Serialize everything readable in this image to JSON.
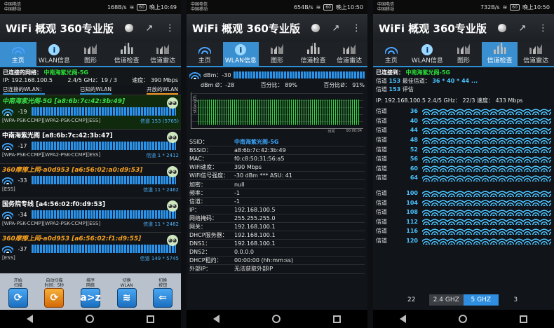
{
  "statusbars": [
    {
      "carrier1": "中国电信",
      "carrier2": "中国移动",
      "speed": "168B/s",
      "battery": "60",
      "time": "晚上10:49"
    },
    {
      "carrier1": "中国电信",
      "carrier2": "中国移动",
      "speed": "654B/s",
      "battery": "60",
      "time": "晚上10:50"
    },
    {
      "carrier1": "中国电信",
      "carrier2": "中国移动",
      "speed": "732B/s",
      "battery": "60",
      "time": "晚上10:50"
    }
  ],
  "app_title": "WiFi 概观 360专业版",
  "tabs": [
    "主页",
    "WLAN信息",
    "图形",
    "信道检查",
    "信道雷达"
  ],
  "panel1": {
    "connected_label": "已连接的网络：",
    "connected_ssid": "中南海紫光阁-5G",
    "ip_line": "IP: 192.168.100.5",
    "band_line": "2.4/5 GHz：19 / 3",
    "speed_line": "速度：  390 Mbps",
    "filter_connected": "已连接的WLAN：",
    "filter_known": "已知的WLAN",
    "filter_open": "开放的WLAN",
    "networks": [
      {
        "name": "中南海紫光阁-5G [a8:6b:7c:42:3b:49]",
        "dbm": "-19",
        "sec": "[WPA-PSK-CCMP][WPA2-PSK-CCMP][ESS]",
        "ch": "信道 153 (5765)",
        "style": "g"
      },
      {
        "name": "中南海紫光阁 [a8:6b:7c:42:3b:47]",
        "dbm": "-17",
        "sec": "[WPA-PSK-CCMP][WPA2-PSK-CCMP][ESS]",
        "ch": "信道 1 * 2412",
        "style": "w"
      },
      {
        "name": "360摩擦上网-a0d953 [a6:56:02:a0:d9:53]",
        "dbm": "-33",
        "sec": "[ESS]",
        "ch": "信道 11 * 2462",
        "style": "o"
      },
      {
        "name": "国务院专线 [a4:56:02:f0:d9:53]",
        "dbm": "-34",
        "sec": "[WPA-PSK-CCMP][WPA2-PSK-CCMP][ESS]",
        "ch": "信道 11 * 2462",
        "style": "w"
      },
      {
        "name": "360摩擦上网-a0d953 [a6:56:02:f1:d9:55]",
        "dbm": "-37",
        "sec": "[ESS]",
        "ch": "信道 149 * 5745",
        "style": "o"
      }
    ],
    "toolbar": [
      {
        "label": "开始\n扫描",
        "icon": "⟳",
        "style": "blue"
      },
      {
        "label": "自动扫描\n时间：5秒",
        "icon": "⟳",
        "style": "orange"
      },
      {
        "label": "排序\n网络",
        "icon": "a>z",
        "style": "blue"
      },
      {
        "label": "切换\nWLAN",
        "icon": "≋",
        "style": "blue"
      },
      {
        "label": "切换\n按钮",
        "icon": "⇐",
        "style": "blue"
      }
    ]
  },
  "panel2": {
    "dbm_label": "dBm：-30",
    "dbm_avg": "dBm Ø：-28",
    "pct": "百分比：  89%",
    "pct_avg": "百分比Ø：  91%",
    "graph_ylabel": "strength",
    "graph_t1": "时间",
    "graph_t2": "00:00:04",
    "rows": [
      {
        "k": "SSID：",
        "v": "中南海紫光阁-5G",
        "b": true
      },
      {
        "k": "BSSID：",
        "v": "a8:6b:7c:42:3b:49"
      },
      {
        "k": "MAC：",
        "v": "f0:c8:50:31:56:a5"
      },
      {
        "k": "WiFi速度：",
        "v": "390 Mbps"
      },
      {
        "k": "WiFi信号强度：",
        "v": "-30 dBm *** ASU: 41"
      },
      {
        "k": "加密：",
        "v": "null"
      },
      {
        "k": "频率：",
        "v": "-1"
      },
      {
        "k": "信道：",
        "v": "-1"
      },
      {
        "k": "IP：",
        "v": "192.168.100.5"
      },
      {
        "k": "网络掩码：",
        "v": "255.255.255.0"
      },
      {
        "k": "网关：",
        "v": "192.168.100.1"
      },
      {
        "k": "DHCP服务器：",
        "v": "192.168.100.1"
      },
      {
        "k": "DNS1：",
        "v": "192.168.100.1"
      },
      {
        "k": "DNS2：",
        "v": "0.0.0.0"
      },
      {
        "k": "DHCP租约：",
        "v": "00:00:00 (hh:mm:ss)"
      },
      {
        "k": "外部IP：",
        "v": "无法获取外部IP"
      }
    ]
  },
  "panel3": {
    "connected_label": "已连接到：",
    "connected_ssid": "中南海紫光阁-5G",
    "ch_label": "信道",
    "ch_val": "153",
    "best_label": "最佳信道：",
    "best_val": "36 * 40 * 44 ...",
    "rating_label": "信道",
    "rating_val": "153",
    "rating_word": "评估",
    "ip_line": "IP: 192.168.100.5   2.4/5 GHz： 22/3   速度：  433 Mbps",
    "channels_a": [
      "36",
      "40",
      "44",
      "48",
      "52",
      "56",
      "60",
      "64"
    ],
    "channels_b": [
      "100",
      "104",
      "108",
      "112",
      "116",
      "120"
    ],
    "band_tabs": [
      "22",
      "2.4 GHZ",
      "5 GHZ",
      "3"
    ]
  }
}
